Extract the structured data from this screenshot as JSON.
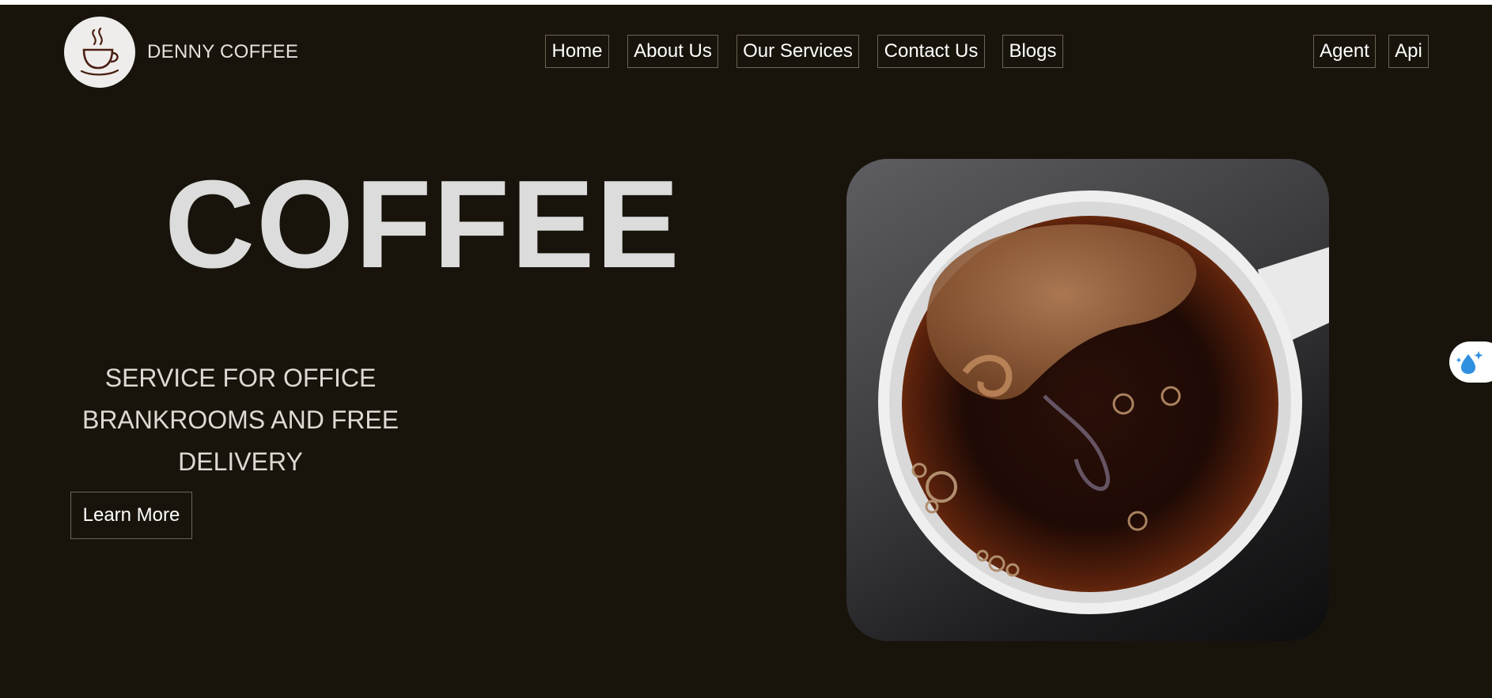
{
  "brand": {
    "name": "DENNY COFFEE",
    "logo_icon": "coffee-cup-icon"
  },
  "nav": {
    "items": [
      {
        "label": "Home"
      },
      {
        "label": "About Us"
      },
      {
        "label": "Our Services"
      },
      {
        "label": "Contact Us"
      },
      {
        "label": "Blogs"
      }
    ],
    "right_items": [
      {
        "label": "Agent"
      },
      {
        "label": "Api"
      }
    ]
  },
  "hero": {
    "title": "COFFEE",
    "subtitle": "SERVICE FOR OFFICE BRANKROOMS AND FREE DELIVERY",
    "cta_label": "Learn More",
    "image_icon": "coffee-cup-photo"
  },
  "widget": {
    "icon": "water-drop-sparkle-icon"
  },
  "colors": {
    "background": "#18140b",
    "border": "#6d6352",
    "text": "#ffffff",
    "title": "#dcdcdc",
    "widget_accent": "#2f8fe0"
  }
}
